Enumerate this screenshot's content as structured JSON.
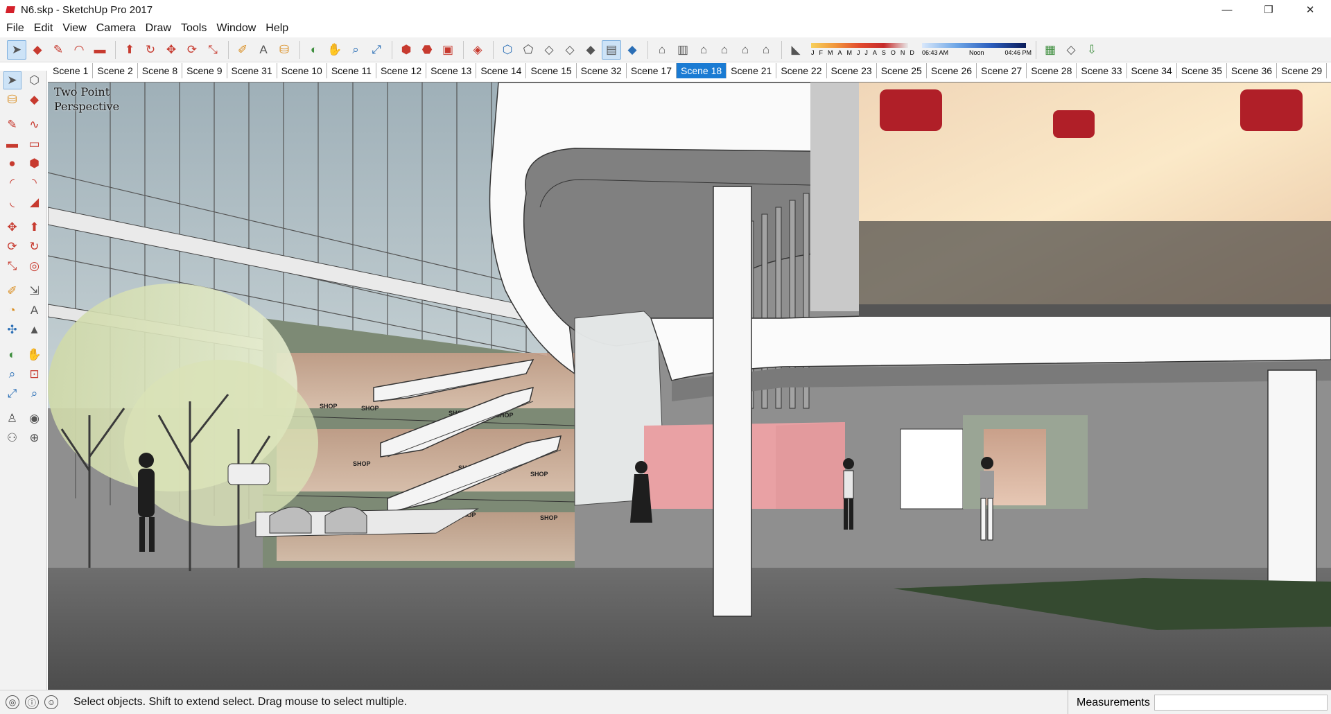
{
  "window": {
    "title": "N6.skp - SketchUp Pro 2017",
    "controls": {
      "minimize": "—",
      "maximize": "❐",
      "close": "✕"
    }
  },
  "menu": [
    "File",
    "Edit",
    "View",
    "Camera",
    "Draw",
    "Tools",
    "Window",
    "Help"
  ],
  "toolbar": {
    "shadow_months": [
      "J",
      "F",
      "M",
      "A",
      "M",
      "J",
      "J",
      "A",
      "S",
      "O",
      "N",
      "D"
    ],
    "time_start": "06:43 AM",
    "time_noon": "Noon",
    "time_end": "04:46 PM"
  },
  "scenes": {
    "tabs": [
      "Scene 1",
      "Scene 2",
      "Scene 8",
      "Scene 9",
      "Scene 31",
      "Scene 10",
      "Scene 11",
      "Scene 12",
      "Scene 13",
      "Scene 14",
      "Scene 15",
      "Scene 32",
      "Scene 17",
      "Scene 18",
      "Scene 21",
      "Scene 22",
      "Scene 23",
      "Scene 25",
      "Scene 26",
      "Scene 27",
      "Scene 28",
      "Scene 33",
      "Scene 34",
      "Scene 35",
      "Scene 36",
      "Scene 29"
    ],
    "active": "Scene 18"
  },
  "viewport": {
    "camera_label_line1": "Two Point",
    "camera_label_line2": "Perspective",
    "shop_sign": "SHOP"
  },
  "status": {
    "hint": "Select objects. Shift to extend select. Drag mouse to select multiple.",
    "measurements_label": "Measurements",
    "measurements_value": ""
  }
}
